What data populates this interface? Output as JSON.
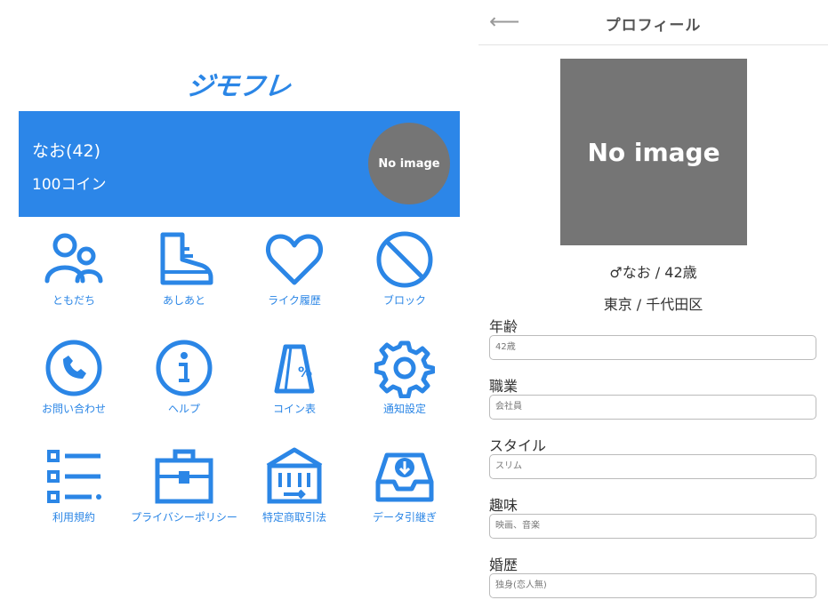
{
  "app": {
    "logo_text": "ジモフレ"
  },
  "user": {
    "name_age": "なお(42)",
    "coins": "100コイン",
    "avatar_text": "No image"
  },
  "menu": [
    {
      "label": "ともだち",
      "icon": "friends-icon"
    },
    {
      "label": "あしあと",
      "icon": "footprint-shoe-icon"
    },
    {
      "label": "ライク履歴",
      "icon": "heart-icon"
    },
    {
      "label": "ブロック",
      "icon": "block-icon"
    },
    {
      "label": "お問い合わせ",
      "icon": "phone-icon"
    },
    {
      "label": "ヘルプ",
      "icon": "info-icon"
    },
    {
      "label": "コイン表",
      "icon": "coin-table-icon"
    },
    {
      "label": "通知設定",
      "icon": "gear-icon"
    },
    {
      "label": "利用規約",
      "icon": "list-icon"
    },
    {
      "label": "プライバシーポリシー",
      "icon": "briefcase-icon"
    },
    {
      "label": "特定商取引法",
      "icon": "bank-icon"
    },
    {
      "label": "データ引継ぎ",
      "icon": "inbox-download-icon"
    }
  ],
  "profile": {
    "back_icon": "back-arrow-icon",
    "title": "プロフィール",
    "photo_text": "No image",
    "gender_name_age": "♂なお / 42歳",
    "location": "東京 / 千代田区",
    "fields": [
      {
        "label": "年齢",
        "value": "42歳"
      },
      {
        "label": "職業",
        "value": "会社員"
      },
      {
        "label": "スタイル",
        "value": "スリム"
      },
      {
        "label": "趣味",
        "value": "映画、音楽"
      },
      {
        "label": "婚歴",
        "value": "独身(恋人無)"
      }
    ]
  },
  "colors": {
    "accent": "#2b86e6",
    "banner": "#2c86e8",
    "placeholder_gray": "#757575"
  }
}
